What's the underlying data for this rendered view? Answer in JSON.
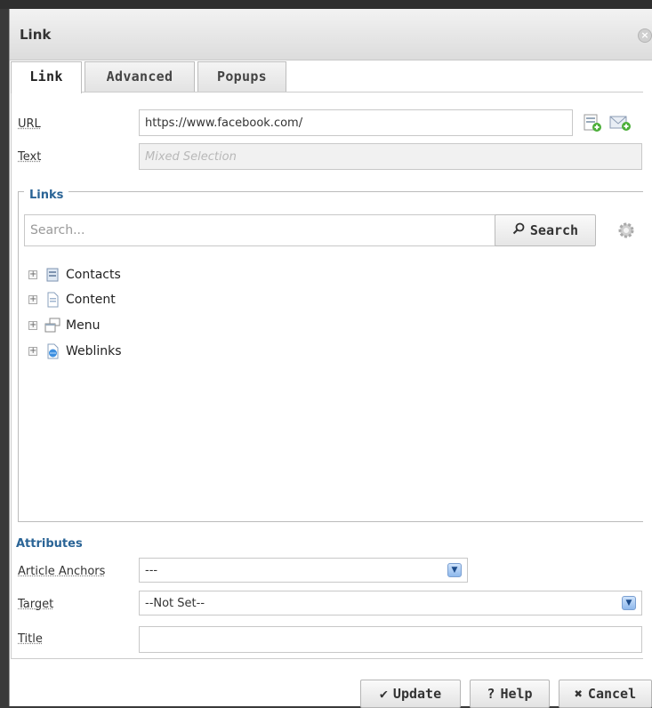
{
  "dialog": {
    "title": "Link"
  },
  "tabs": [
    {
      "label": "Link",
      "active": true
    },
    {
      "label": "Advanced",
      "active": false
    },
    {
      "label": "Popups",
      "active": false
    }
  ],
  "form": {
    "url_label": "URL",
    "url_value": "https://www.facebook.com/",
    "text_label": "Text",
    "text_placeholder": "Mixed Selection"
  },
  "links": {
    "legend": "Links",
    "search_placeholder": "Search...",
    "search_button": "Search",
    "tree": [
      {
        "label": "Contacts",
        "icon": "contacts-icon"
      },
      {
        "label": "Content",
        "icon": "content-icon"
      },
      {
        "label": "Menu",
        "icon": "menu-icon"
      },
      {
        "label": "Weblinks",
        "icon": "weblinks-icon"
      }
    ]
  },
  "attributes": {
    "title": "Attributes",
    "anchors_label": "Article Anchors",
    "anchors_value": "---",
    "target_label": "Target",
    "target_value": "--Not Set--",
    "title_label": "Title",
    "title_value": ""
  },
  "buttons": {
    "update": "Update",
    "help": "Help",
    "cancel": "Cancel"
  },
  "colors": {
    "accent": "#2a6496",
    "select_arrow": "#8eb8ec"
  }
}
